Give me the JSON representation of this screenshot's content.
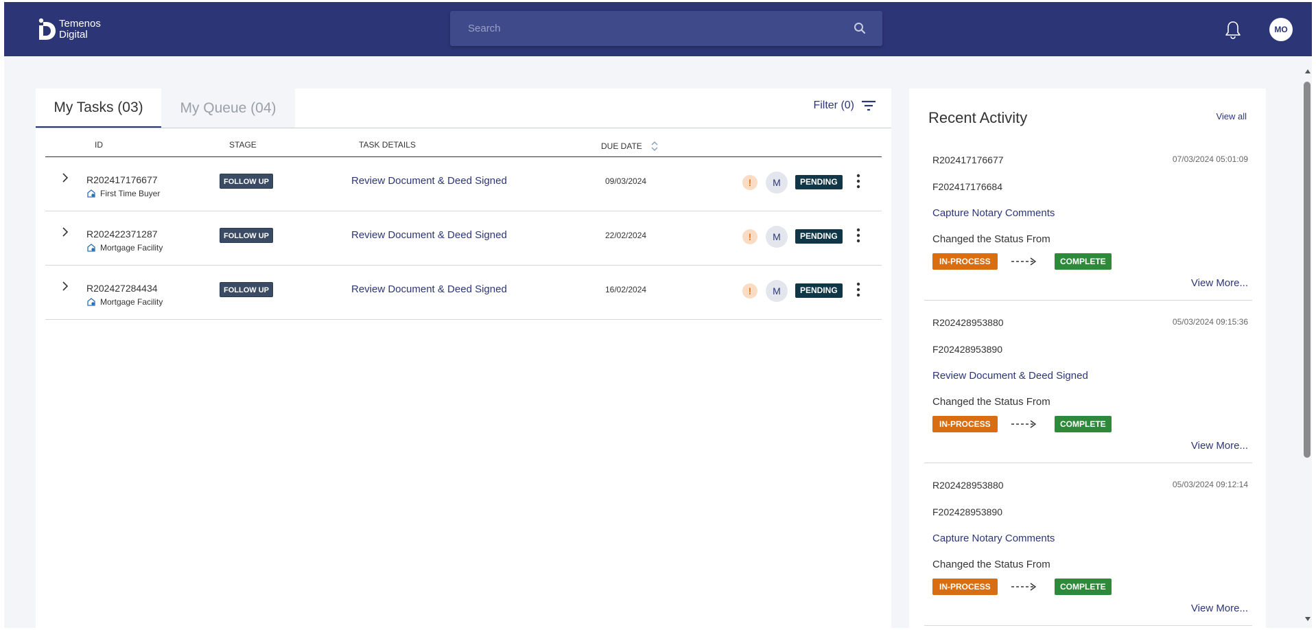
{
  "header": {
    "logo_line1": "Temenos",
    "logo_line2": "Digital",
    "search_placeholder": "Search",
    "avatar_initials": "MO",
    "bg_color": "#2c3677"
  },
  "tasks": {
    "tabs": [
      {
        "label": "My Tasks (03)",
        "active": true
      },
      {
        "label": "My Queue (04)",
        "active": false
      }
    ],
    "filter_label": "Filter (0)",
    "columns": {
      "id": "ID",
      "stage": "STAGE",
      "task_details": "TASK DETAILS",
      "due_date": "DUE DATE"
    },
    "rows": [
      {
        "id": "R202417176677",
        "sub": "First Time Buyer",
        "stage": "FOLLOW UP",
        "task": "Review Document & Deed Signed",
        "due": "09/03/2024",
        "warn": "!",
        "assignee": "M",
        "status": "PENDING"
      },
      {
        "id": "R202422371287",
        "sub": "Mortgage Facility",
        "stage": "FOLLOW UP",
        "task": "Review Document & Deed Signed",
        "due": "22/02/2024",
        "warn": "!",
        "assignee": "M",
        "status": "PENDING"
      },
      {
        "id": "R202427284434",
        "sub": "Mortgage Facility",
        "stage": "FOLLOW UP",
        "task": "Review Document & Deed Signed",
        "due": "16/02/2024",
        "warn": "!",
        "assignee": "M",
        "status": "PENDING"
      }
    ]
  },
  "activity": {
    "title": "Recent Activity",
    "view_all": "View all",
    "items": [
      {
        "id": "R202417176677",
        "time": "07/03/2024 05:01:09",
        "fid": "F202417176684",
        "task": "Capture Notary Comments",
        "changed": "Changed the Status From",
        "from": "IN-PROCESS",
        "to": "COMPLETE",
        "more": "View More..."
      },
      {
        "id": "R202428953880",
        "time": "05/03/2024 09:15:36",
        "fid": "F202428953890",
        "task": "Review Document & Deed Signed",
        "changed": "Changed the Status From",
        "from": "IN-PROCESS",
        "to": "COMPLETE",
        "more": "View More..."
      },
      {
        "id": "R202428953880",
        "time": "05/03/2024 09:12:14",
        "fid": "F202428953890",
        "task": "Capture Notary Comments",
        "changed": "Changed the Status From",
        "from": "IN-PROCESS",
        "to": "COMPLETE",
        "more": "View More..."
      }
    ]
  }
}
